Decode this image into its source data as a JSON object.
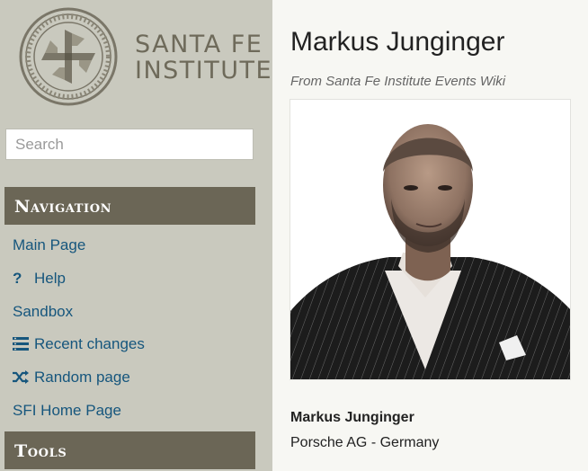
{
  "brand": {
    "line1": "SANTA FE",
    "line2": "INSTITUTE"
  },
  "search": {
    "placeholder": "Search"
  },
  "navigation": {
    "heading": "Navigation",
    "items": [
      {
        "label": "Main Page",
        "icon": ""
      },
      {
        "label": "Help",
        "icon": "question-icon"
      },
      {
        "label": "Sandbox",
        "icon": ""
      },
      {
        "label": "Recent changes",
        "icon": "list-icon"
      },
      {
        "label": "Random page",
        "icon": "shuffle-icon"
      },
      {
        "label": "SFI Home Page",
        "icon": ""
      }
    ]
  },
  "tools": {
    "heading": "Tools"
  },
  "page": {
    "title": "Markus Junginger",
    "subtitle": "From Santa Fe Institute Events Wiki",
    "caption_name": "Markus Junginger",
    "caption_org": "Porsche AG - Germany"
  },
  "colors": {
    "sidebar_bg": "#c9c9be",
    "portal_header": "#6b6656",
    "link": "#16567d",
    "content_bg": "#f7f7f3"
  }
}
